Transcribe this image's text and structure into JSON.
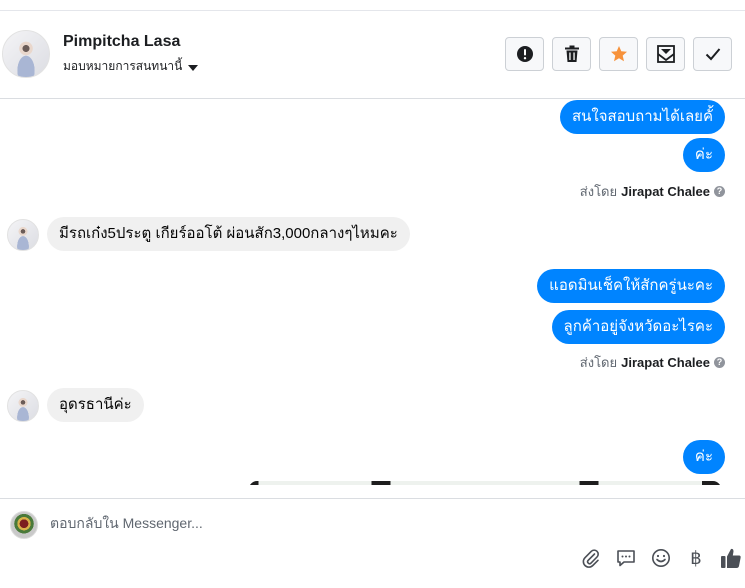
{
  "header": {
    "contact_name": "Pimpitcha Lasa",
    "assign_label": "มอบหมายการสนทนานี้"
  },
  "actions": [
    {
      "name": "spam-button",
      "icon": "alert-icon"
    },
    {
      "name": "delete-button",
      "icon": "trash-icon"
    },
    {
      "name": "star-button",
      "icon": "star-icon",
      "color": "#f7923b"
    },
    {
      "name": "mark-unread-button",
      "icon": "envelope-icon"
    },
    {
      "name": "done-button",
      "icon": "check-icon"
    }
  ],
  "messages": [
    {
      "direction": "out",
      "text": "สนใจสอบถามได้เลยคั้"
    },
    {
      "direction": "out",
      "text": "ค่ะ"
    },
    {
      "direction": "in",
      "text": "มีรถเก๋ง5ประตู เกียร์ออโต้ ผ่อนสัก3,000กลางๆไหมคะ"
    },
    {
      "direction": "out",
      "text": "แอดมินเช็คให้สักครู่นะคะ"
    },
    {
      "direction": "out",
      "text": "ลูกค้าอยู่จังหวัดอะไรคะ"
    },
    {
      "direction": "in",
      "text": "อุดรธานีค่ะ"
    },
    {
      "direction": "out",
      "text": "ค่ะ"
    }
  ],
  "sent_by": {
    "prefix": "ส่งโดย",
    "agent": "Jirapat Chalee"
  },
  "composer": {
    "placeholder": "ตอบกลับใน Messenger...",
    "currency_symbol": "฿"
  },
  "colors": {
    "outgoing_bubble": "#0084ff",
    "incoming_bubble": "#f0f0f0",
    "like_icon": "#4b4f56"
  }
}
